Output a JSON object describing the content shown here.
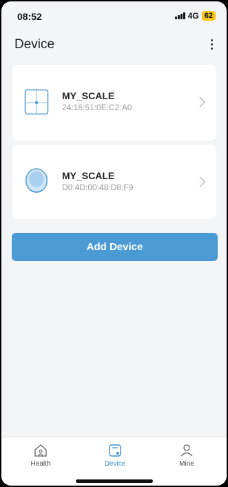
{
  "status_bar": {
    "time": "08:52",
    "network": "4G",
    "battery": "62"
  },
  "header": {
    "title": "Device",
    "menu_icon": "more-vertical-icon"
  },
  "devices": [
    {
      "name": "MY_SCALE",
      "mac": "24:16:51:0E:C2:A0",
      "icon": "square-scale-icon"
    },
    {
      "name": "MY_SCALE",
      "mac": "D0:4D:00:48:D8:F9",
      "icon": "round-scale-icon"
    }
  ],
  "add_button": {
    "label": "Add Device"
  },
  "bottom_nav": {
    "items": [
      {
        "label": "Health",
        "icon": "home-icon",
        "active": false
      },
      {
        "label": "Device",
        "icon": "device-icon",
        "active": true
      },
      {
        "label": "Mine",
        "icon": "person-icon",
        "active": false
      }
    ]
  },
  "colors": {
    "accent": "#4b9ad3",
    "active_nav": "#3d8fd0",
    "background": "#f4f5f7",
    "battery": "#f5c518"
  }
}
